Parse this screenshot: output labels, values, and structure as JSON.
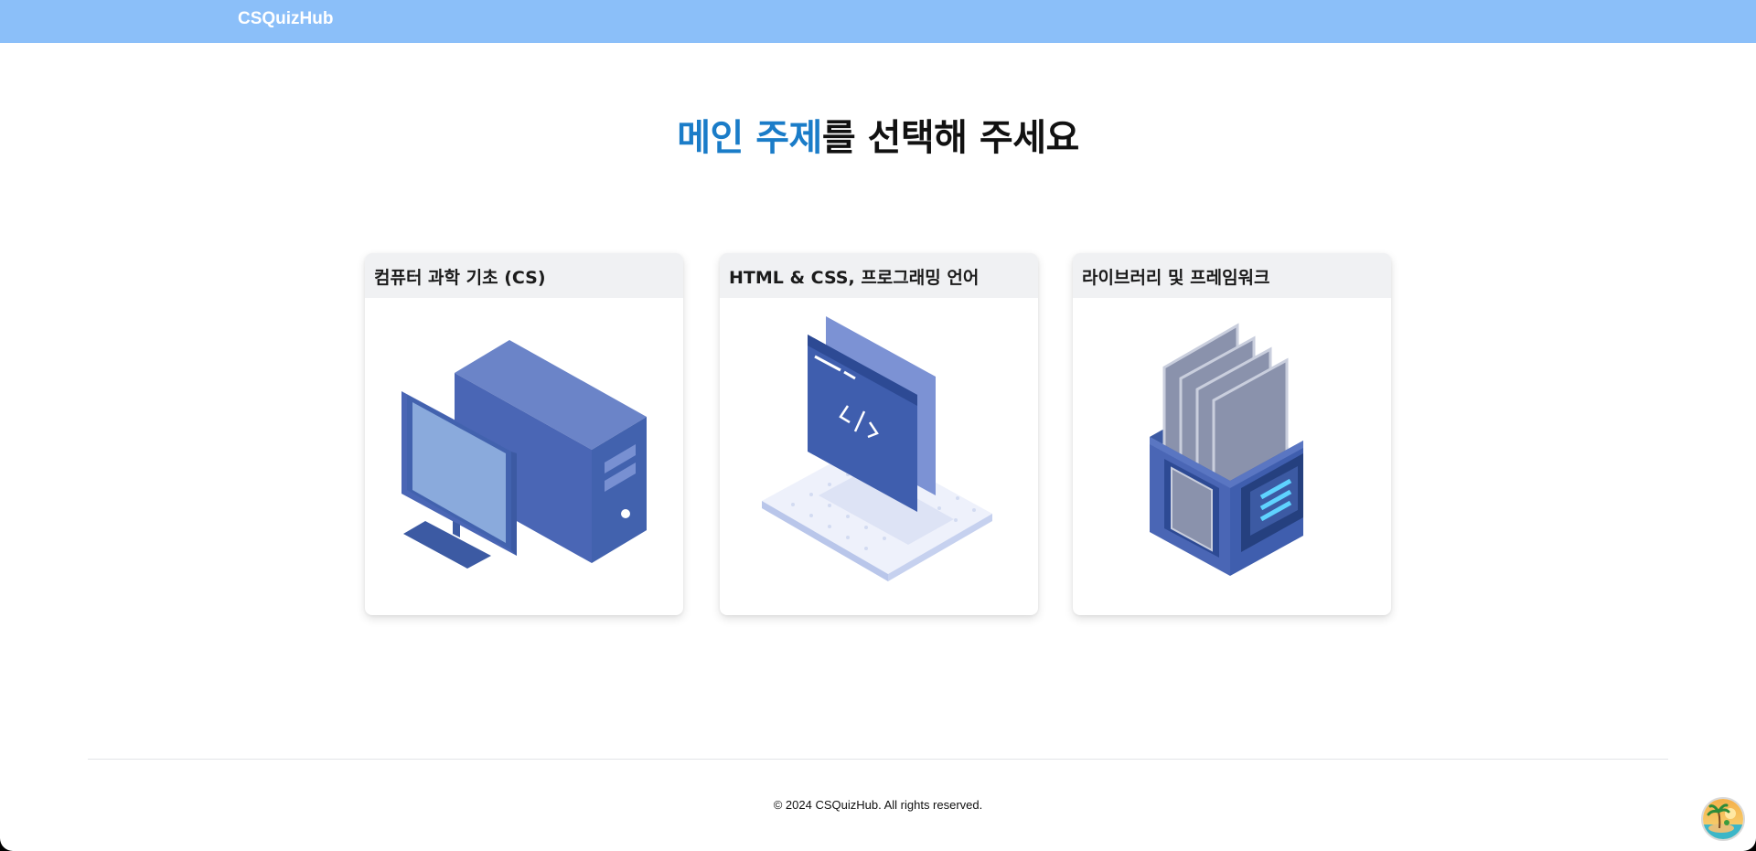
{
  "header": {
    "brand": "CSQuizHub",
    "bg_color": "#8bbff9"
  },
  "main": {
    "title_accent": "메인 주제",
    "title_rest": "를 선택해 주세요",
    "accent_color": "#1a7cc8",
    "cards": [
      {
        "title": "컴퓨터 과학 기초 (CS)",
        "illustration": "desktop-computer-icon"
      },
      {
        "title": "HTML & CSS, 프로그래밍 언어",
        "illustration": "code-window-laptop-icon"
      },
      {
        "title": "라이브러리 및 프레임워크",
        "illustration": "library-books-box-icon"
      }
    ]
  },
  "footer": {
    "copyright": "© 2024 CSQuizHub. All rights reserved."
  },
  "avatar": {
    "icon": "tropical-island-avatar-icon"
  }
}
